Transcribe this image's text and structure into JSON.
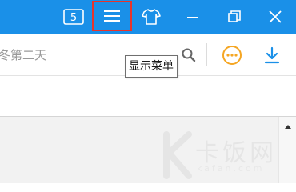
{
  "titlebar": {
    "tab_count": "5",
    "colors": {
      "background": "#1a90e8",
      "highlight_border": "#e8342c"
    },
    "buttons": [
      {
        "name": "tab-count-button",
        "icon": "tab-count-icon"
      },
      {
        "name": "show-menu-button",
        "icon": "hamburger-menu-icon"
      },
      {
        "name": "skin-button",
        "icon": "tshirt-icon"
      },
      {
        "name": "minimize-button",
        "icon": "minimize-icon"
      },
      {
        "name": "restore-button",
        "icon": "restore-icon"
      },
      {
        "name": "close-button",
        "icon": "close-icon"
      }
    ]
  },
  "addressbar": {
    "text": "冬第二天",
    "icons": {
      "search": "search-icon",
      "more": "more-circle-icon",
      "download": "download-icon"
    },
    "colors": {
      "more": "#f5a623",
      "download": "#1a90e8"
    }
  },
  "tooltip": {
    "text": "显示菜单"
  },
  "watermark": {
    "text": "卡饭网",
    "sub": "kafan.com"
  }
}
